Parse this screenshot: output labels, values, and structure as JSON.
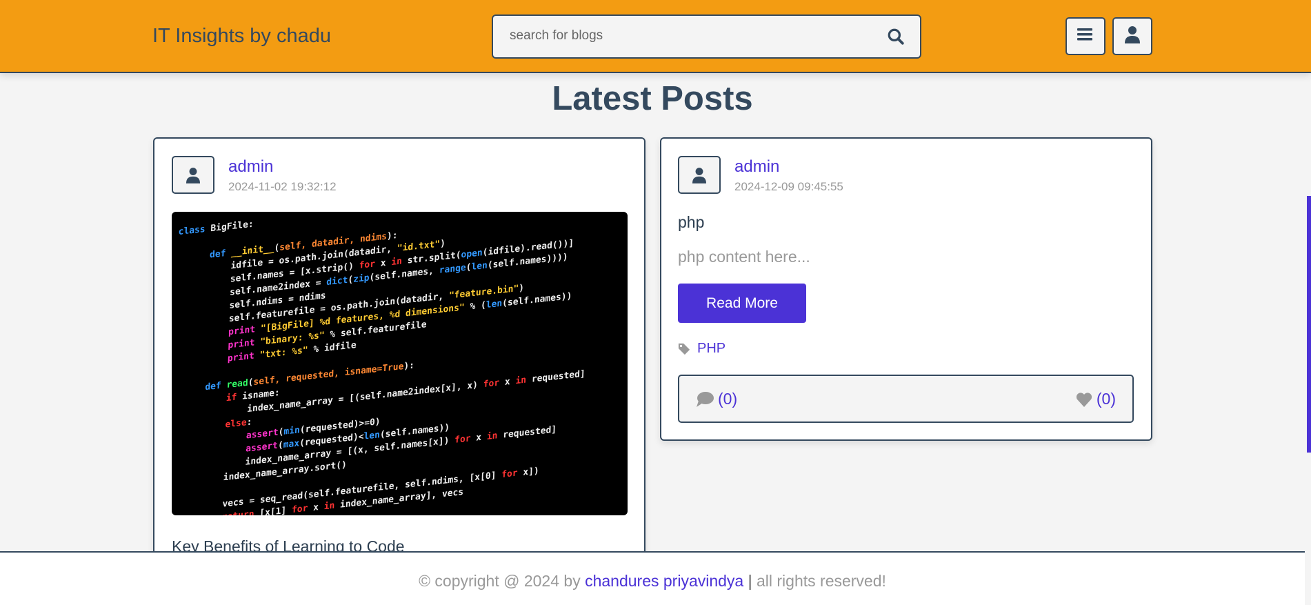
{
  "header": {
    "brand": "IT Insights by chadu",
    "search_placeholder": "search for blogs"
  },
  "page_title": "Latest Posts",
  "posts": [
    {
      "author": "admin",
      "date": "2024-11-02 19:32:12",
      "title": "Key Benefits of Learning to Code",
      "image_alt": "code screenshot"
    },
    {
      "author": "admin",
      "date": "2024-12-09 09:45:55",
      "title": "php",
      "excerpt": "php content here...",
      "read_more": "Read More",
      "tag": "PHP",
      "comments": "(0)",
      "likes": "(0)"
    }
  ],
  "footer": {
    "prefix": "© copyright @ 2024 by",
    "author": "chandures priyavindya",
    "separator": "|",
    "suffix": "all rights reserved!"
  },
  "colors": {
    "header": "#f39c12",
    "accent": "#4b32d6",
    "dark": "#34495e"
  }
}
